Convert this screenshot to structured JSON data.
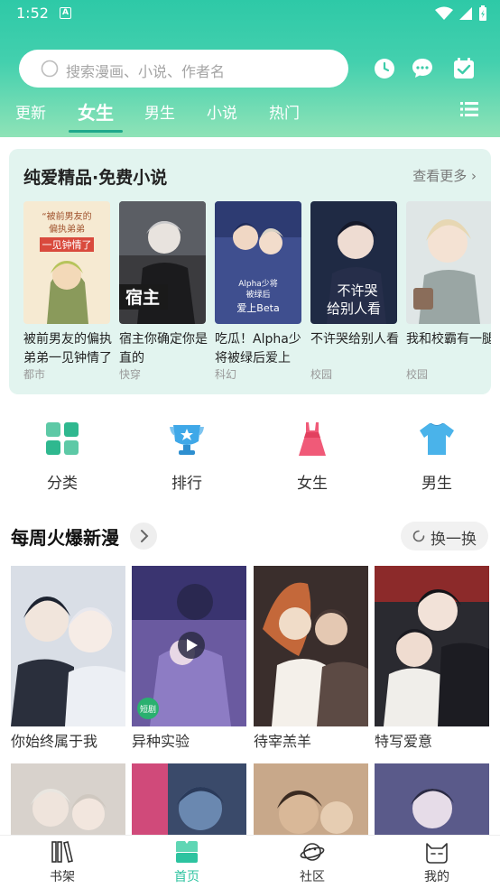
{
  "status": {
    "time": "1:52",
    "notif": "A"
  },
  "search": {
    "placeholder": "搜索漫画、小说、作者名"
  },
  "tabs": [
    "更新",
    "女生",
    "男生",
    "小说",
    "热门"
  ],
  "novel_section": {
    "title": "纯爱精品·免费小说",
    "more": "查看更多",
    "books": [
      {
        "name": "被前男友的偏执弟弟一见钟情了",
        "genre": "都市",
        "cover_text": "被前男友的偏执弟弟一见钟情了"
      },
      {
        "name": "宿主你确定你是直的",
        "genre": "快穿",
        "cover_text": "宿主"
      },
      {
        "name": "吃瓜！Alpha少将被绿后爱上Beta",
        "genre": "科幻",
        "cover_text": "Alpha少将被绿后爱上Beta"
      },
      {
        "name": "不许哭给别人看",
        "genre": "校园",
        "cover_text": "不许哭给别人看"
      },
      {
        "name": "我和校霸有一腿",
        "genre": "校园",
        "cover_text": ""
      }
    ]
  },
  "quick_links": [
    {
      "label": "分类",
      "icon": "category-icon"
    },
    {
      "label": "排行",
      "icon": "trophy-icon"
    },
    {
      "label": "女生",
      "icon": "dress-icon"
    },
    {
      "label": "男生",
      "icon": "tshirt-icon"
    }
  ],
  "weekly": {
    "title": "每周火爆新漫",
    "refresh": "换一换",
    "comics": [
      {
        "name": "你始终属于我"
      },
      {
        "name": "异种实验",
        "badge": "短剧"
      },
      {
        "name": "待宰羔羊"
      },
      {
        "name": "特写爱意"
      },
      {
        "name": ""
      },
      {
        "name": ""
      },
      {
        "name": ""
      },
      {
        "name": ""
      }
    ]
  },
  "bottom_nav": [
    {
      "label": "书架",
      "icon": "bookshelf-icon"
    },
    {
      "label": "首页",
      "icon": "home-icon"
    },
    {
      "label": "社区",
      "icon": "planet-icon"
    },
    {
      "label": "我的",
      "icon": "cat-icon"
    }
  ],
  "colors": {
    "accent": "#2dc3a0",
    "header_top": "#2ec9a7",
    "header_bottom": "#8fe3b7",
    "card_bg": "#e2f4ef"
  }
}
